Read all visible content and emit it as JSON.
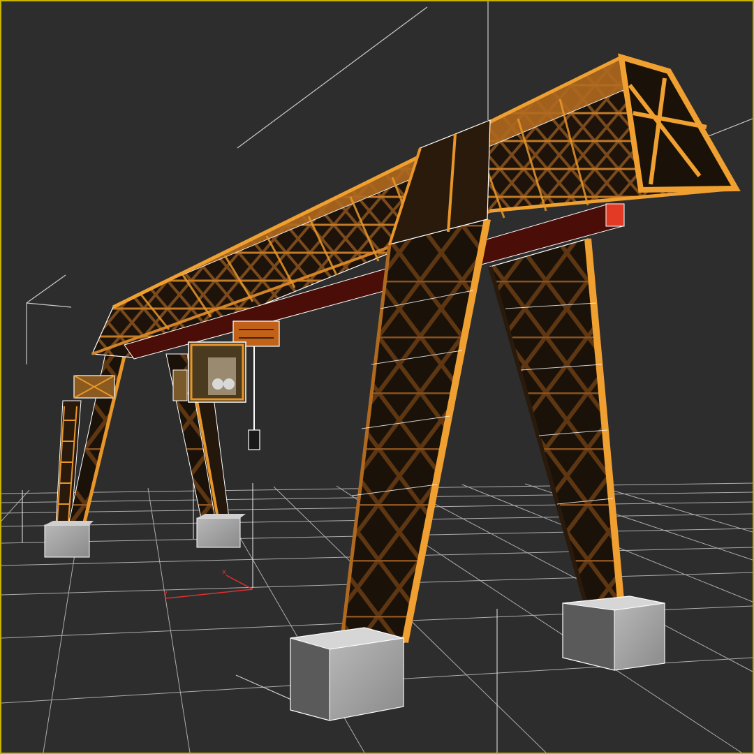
{
  "viewport": {
    "active_border_color": "#c8b400",
    "background_color": "#2d2d2d",
    "grid_color": "#d8d8d8"
  },
  "axis_gizmo": {
    "x_label": "x",
    "y_label": "y",
    "color": "#e03030"
  },
  "model": {
    "structure_color": "#e8962a",
    "frame_dark_color": "#3a2412",
    "girder_rail_color": "#5a0f0a",
    "footing_color": "#9a9a9a",
    "selection_edge_color": "#ffffff"
  }
}
